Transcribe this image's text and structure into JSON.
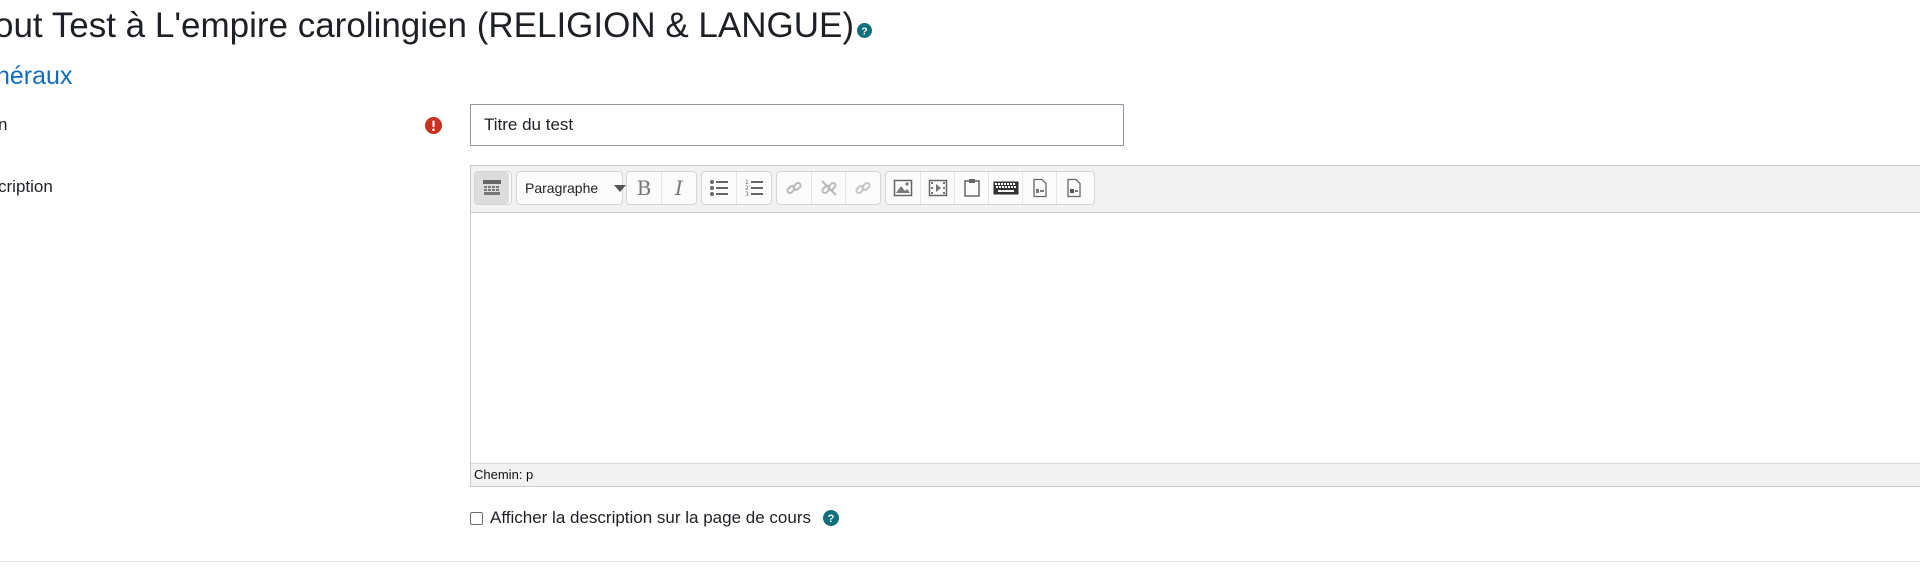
{
  "header": {
    "title": "out Test à L'empire carolingien (RELIGION & LANGUE)"
  },
  "section": {
    "link_text": "néraux"
  },
  "form": {
    "name_label": "n",
    "name_value": "Titre du test",
    "description_label": "cription",
    "editor": {
      "format_select": "Paragraphe",
      "status_path": "Chemin: p",
      "tools": [
        "keyboard-toggle-icon",
        "bold-icon",
        "italic-icon",
        "bullet-list-icon",
        "numbered-list-icon",
        "link-icon",
        "unlink-icon",
        "autolink-icon",
        "image-icon",
        "media-icon",
        "paste-icon",
        "equation-keyboard-icon",
        "file-left-icon",
        "file-right-icon"
      ]
    },
    "show_description_checkbox": {
      "label": "Afficher la description sur la page de cours",
      "checked": false
    }
  },
  "colors": {
    "link": "#0f6cbf",
    "help": "#0f6f7a",
    "required": "#ca3120"
  }
}
